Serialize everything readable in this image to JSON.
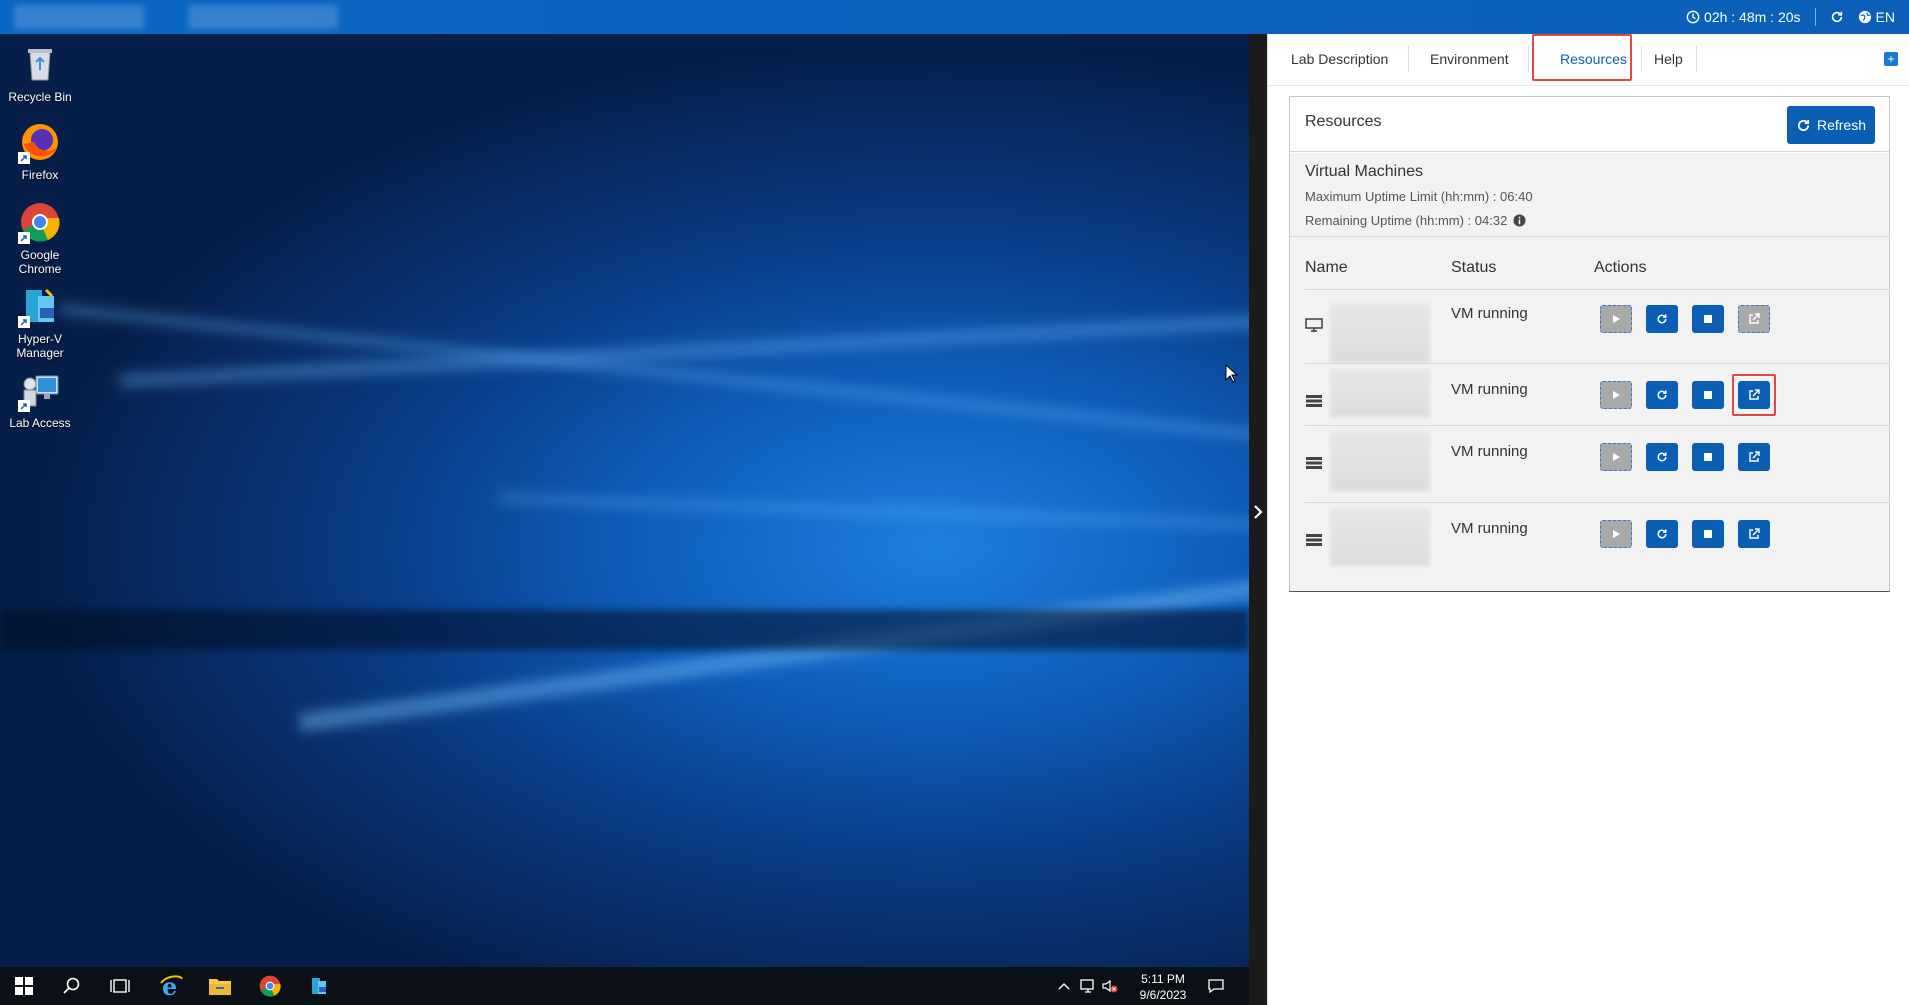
{
  "topbar": {
    "timer": "02h : 48m : 20s",
    "language": "EN"
  },
  "desktop": {
    "icons": [
      {
        "label": "Recycle Bin"
      },
      {
        "label": "Firefox"
      },
      {
        "label": "Google Chrome"
      },
      {
        "label": "Hyper-V Manager"
      },
      {
        "label": "Lab Access"
      }
    ]
  },
  "taskbar": {
    "time": "5:11 PM",
    "date": "9/6/2023"
  },
  "panel": {
    "tabs": [
      {
        "label": "Lab Description"
      },
      {
        "label": "Environment"
      },
      {
        "label": "Resources"
      },
      {
        "label": "Help"
      }
    ],
    "resources": {
      "title": "Resources",
      "refresh_label": "Refresh",
      "vm_section_title": "Virtual Machines",
      "max_uptime": "Maximum Uptime Limit (hh:mm) : 06:40",
      "remaining_uptime": "Remaining Uptime (hh:mm) : 04:32",
      "columns": {
        "name": "Name",
        "status": "Status",
        "actions": "Actions"
      },
      "rows": [
        {
          "status": "VM running"
        },
        {
          "status": "VM running"
        },
        {
          "status": "VM running"
        },
        {
          "status": "VM running"
        }
      ]
    }
  },
  "colors": {
    "accent": "#0a5fb4",
    "highlight": "#e04848"
  }
}
